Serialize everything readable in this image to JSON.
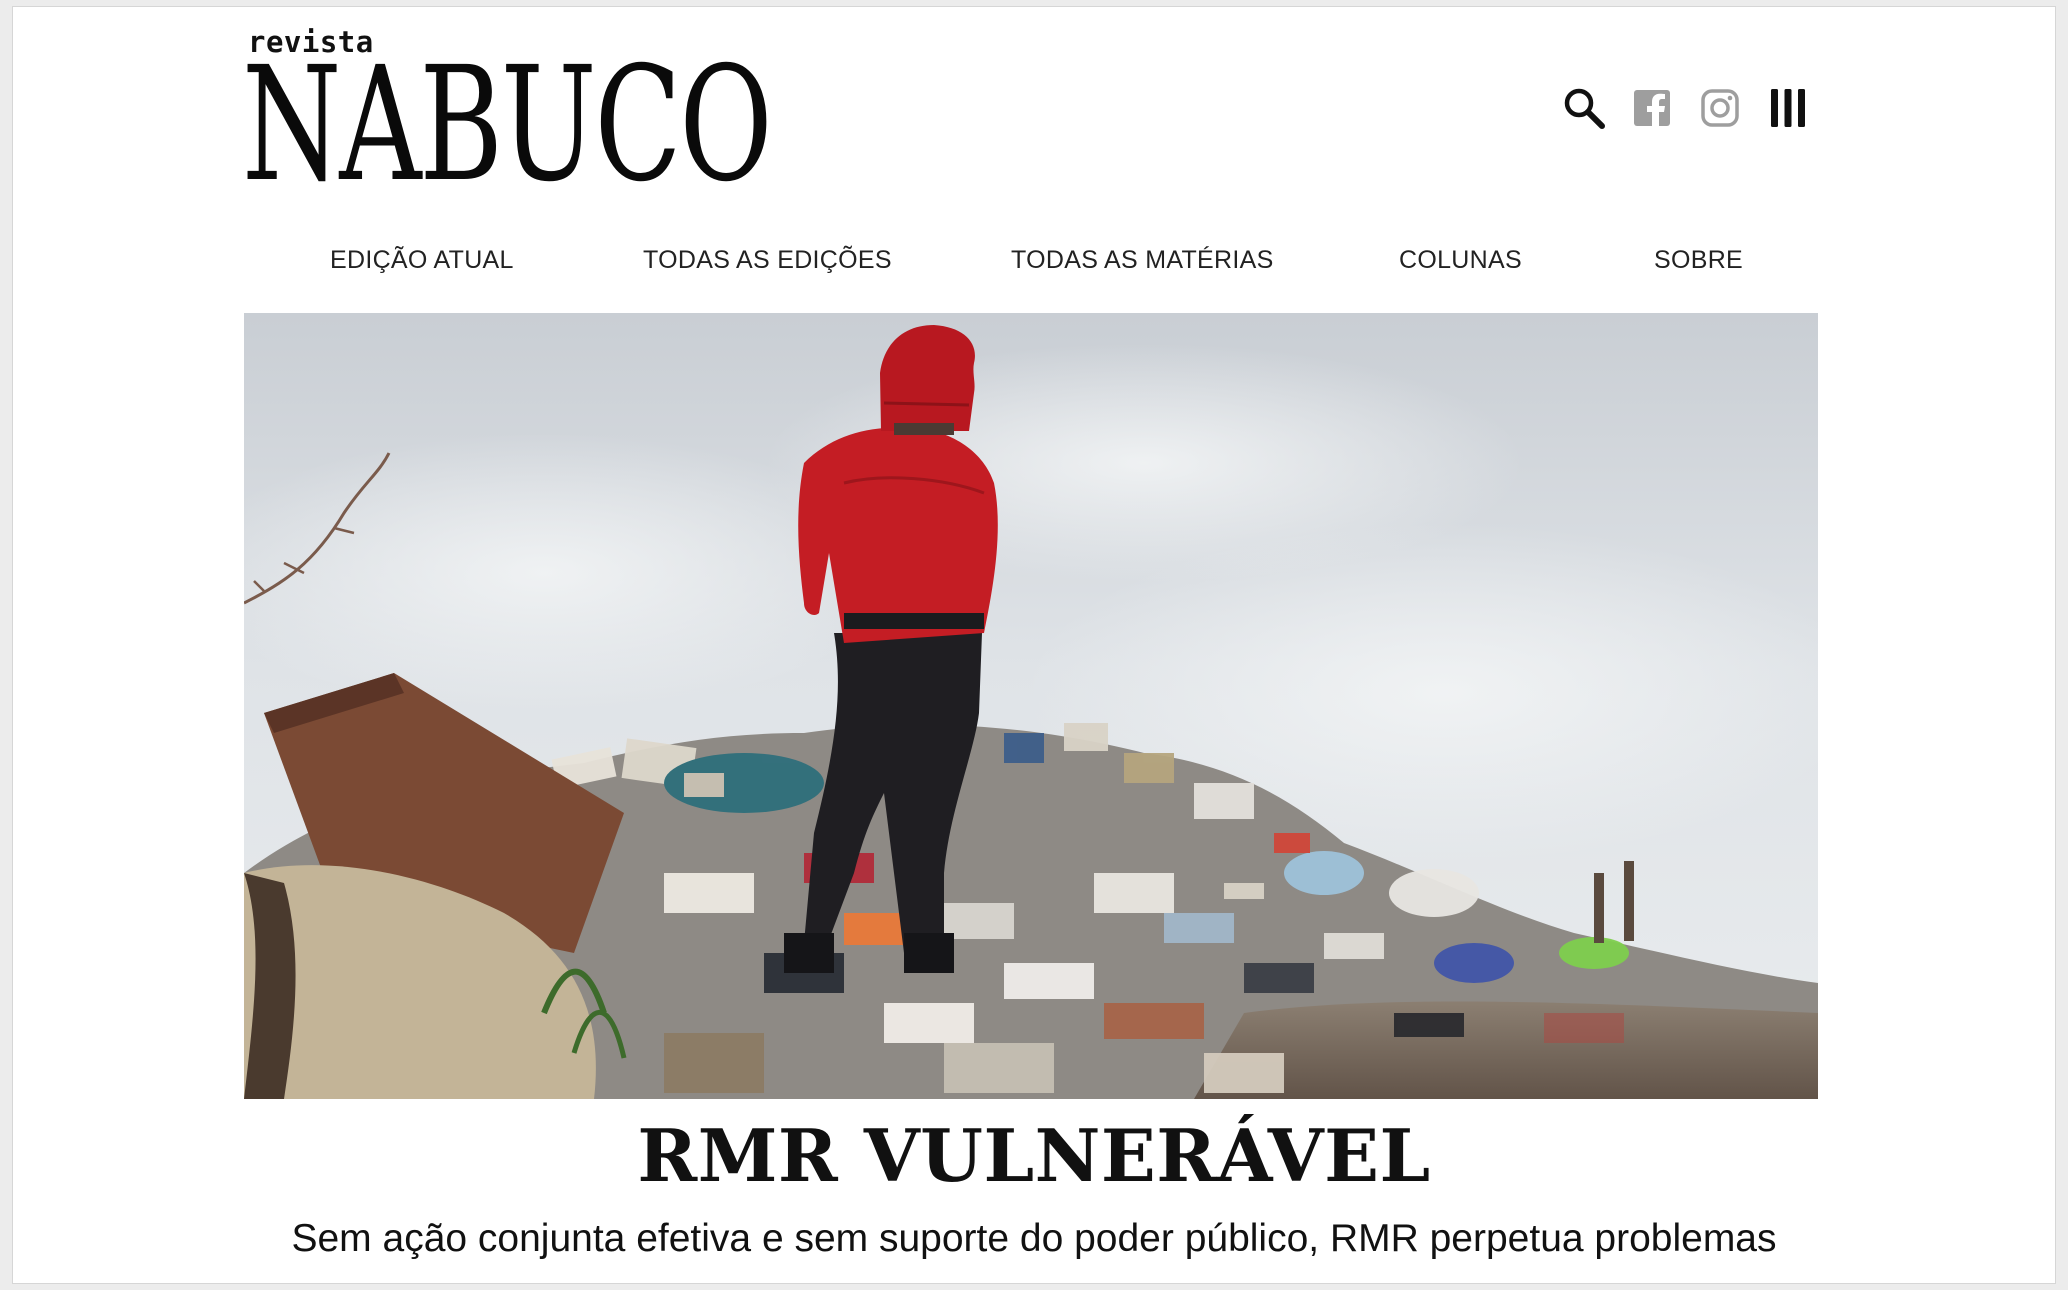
{
  "header": {
    "logo_small": "revista",
    "logo_large": "NABUCO",
    "icons": [
      "search-icon",
      "facebook-icon",
      "instagram-icon",
      "menu-icon"
    ]
  },
  "nav": {
    "items": [
      {
        "label": "EDIÇÃO ATUAL"
      },
      {
        "label": "TODAS AS EDIÇÕES"
      },
      {
        "label": "TODAS AS MATÉRIAS"
      },
      {
        "label": "COLUNAS"
      },
      {
        "label": "SOBRE"
      }
    ]
  },
  "article": {
    "title": "RMR VULNERÁVEL",
    "subtitle": "Sem ação conjunta efetiva e sem suporte do poder público, RMR perpetua problemas"
  },
  "colors": {
    "text": "#111111",
    "icon_gray": "#9e9e9e",
    "hoodie_red": "#c41d24"
  }
}
